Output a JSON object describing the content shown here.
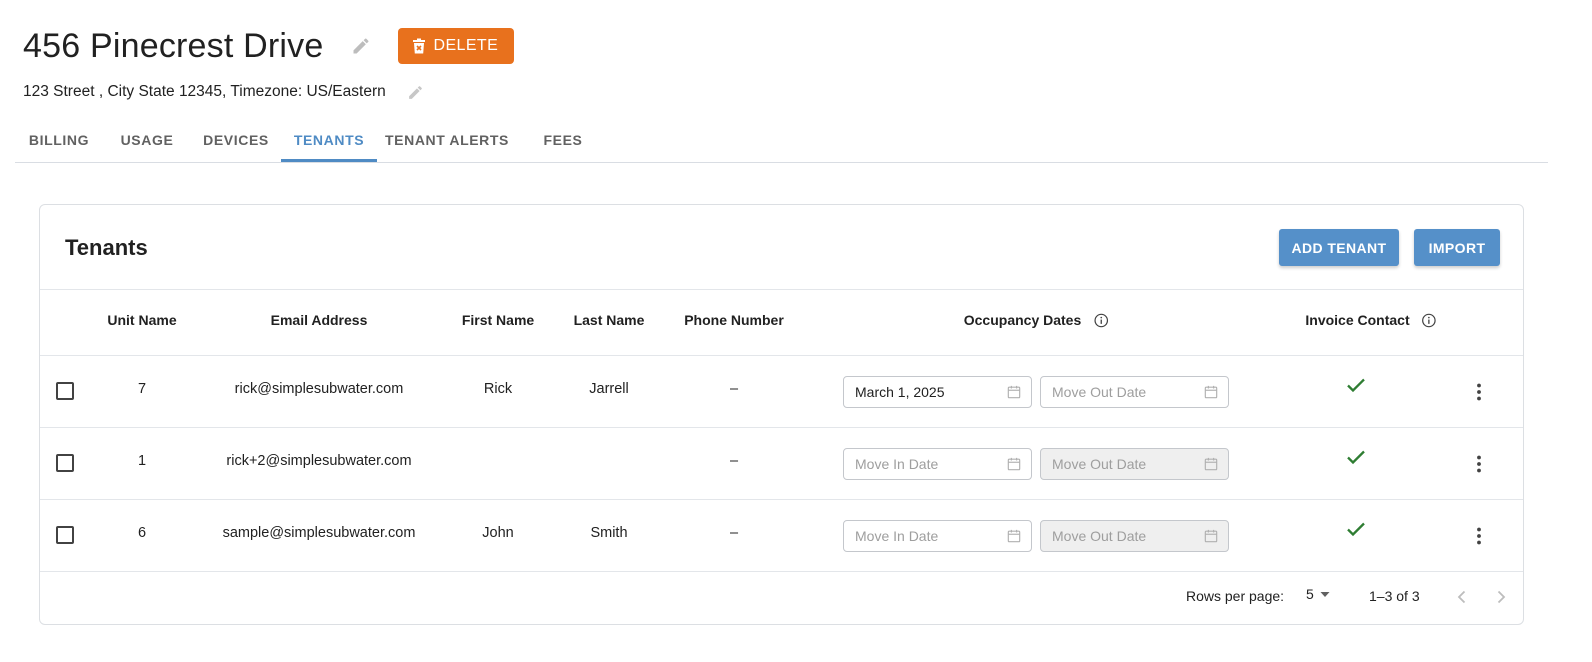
{
  "property": {
    "title": "456 Pinecrest Drive",
    "delete_label": "DELETE",
    "address": "123 Street , City State 12345, Timezone: US/Eastern"
  },
  "tabs": [
    {
      "label": "BILLING",
      "active": false
    },
    {
      "label": "USAGE",
      "active": false
    },
    {
      "label": "DEVICES",
      "active": false
    },
    {
      "label": "TENANTS",
      "active": true
    },
    {
      "label": "TENANT ALERTS",
      "active": false
    },
    {
      "label": "FEES",
      "active": false
    }
  ],
  "card": {
    "title": "Tenants",
    "add_label": "ADD TENANT",
    "import_label": "IMPORT"
  },
  "columns": {
    "unit_name": "Unit Name",
    "email": "Email Address",
    "first_name": "First Name",
    "last_name": "Last Name",
    "phone": "Phone Number",
    "occupancy": "Occupancy Dates",
    "invoice_contact": "Invoice Contact"
  },
  "rows": [
    {
      "unit": "7",
      "email": "rick@simplesubwater.com",
      "first": "Rick",
      "last": "Jarrell",
      "phone": "–",
      "move_in": "March 1, 2025",
      "move_in_placeholder": "Move In Date",
      "move_out": "",
      "move_out_placeholder": "Move Out Date",
      "move_out_disabled": false,
      "invoice_contact": true
    },
    {
      "unit": "1",
      "email": "rick+2@simplesubwater.com",
      "first": "",
      "last": "",
      "phone": "–",
      "move_in": "",
      "move_in_placeholder": "Move In Date",
      "move_out": "",
      "move_out_placeholder": "Move Out Date",
      "move_out_disabled": true,
      "invoice_contact": true
    },
    {
      "unit": "6",
      "email": "sample@simplesubwater.com",
      "first": "John",
      "last": "Smith",
      "phone": "–",
      "move_in": "",
      "move_in_placeholder": "Move In Date",
      "move_out": "",
      "move_out_placeholder": "Move Out Date",
      "move_out_disabled": true,
      "invoice_contact": true
    }
  ],
  "pagination": {
    "rows_per_page_label": "Rows per page:",
    "rows_per_page": "5",
    "range": "1–3 of 3"
  },
  "colors": {
    "accent": "#4f8bc4",
    "button": "#5590c9",
    "delete": "#e8711d",
    "check": "#2e7d32"
  }
}
